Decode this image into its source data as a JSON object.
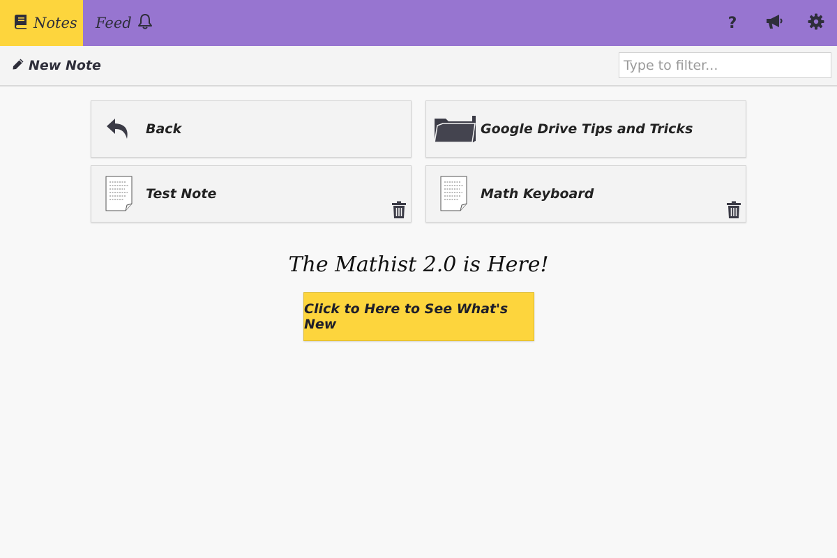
{
  "tabs": [
    {
      "label": "Notes",
      "icon": "book-icon",
      "active": true
    },
    {
      "label": "Feed",
      "icon": "bell-icon",
      "active": false
    }
  ],
  "top_icons": [
    {
      "name": "help-icon",
      "glyph": "?"
    },
    {
      "name": "megaphone-icon"
    },
    {
      "name": "gear-icon"
    }
  ],
  "toolbar": {
    "new_note_label": "New Note",
    "filter_placeholder": "Type to filter..."
  },
  "items": [
    {
      "label": "Back",
      "type": "back"
    },
    {
      "label": "Google Drive Tips and Tricks",
      "type": "folder"
    },
    {
      "label": "Test Note",
      "type": "note",
      "deletable": true
    },
    {
      "label": "Math Keyboard",
      "type": "note",
      "deletable": true
    }
  ],
  "announcement": {
    "title": "The Mathist 2.0 is Here!",
    "button_label": "Click to Here to See What's New"
  },
  "colors": {
    "header_bg": "#9775d0",
    "active_tab_bg": "#fdd53d",
    "button_bg": "#fdd53d",
    "icon_color": "#2e2e3a"
  }
}
